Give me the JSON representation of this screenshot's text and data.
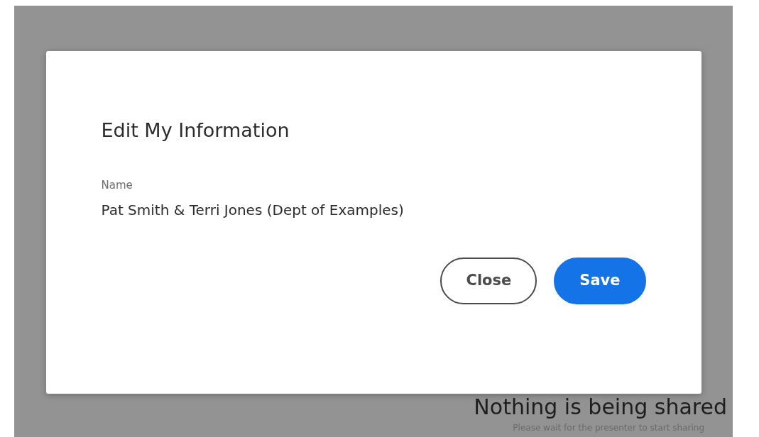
{
  "dialog": {
    "title": "Edit My Information",
    "field": {
      "label": "Name",
      "value": "Pat Smith & Terri Jones (Dept of Examples)"
    },
    "buttons": [
      {
        "label": "Close",
        "kind": "secondary"
      },
      {
        "label": "Save",
        "kind": "primary"
      }
    ]
  },
  "background": {
    "heading": "Nothing is being shared",
    "message": "Please wait for the presenter to start sharing"
  }
}
